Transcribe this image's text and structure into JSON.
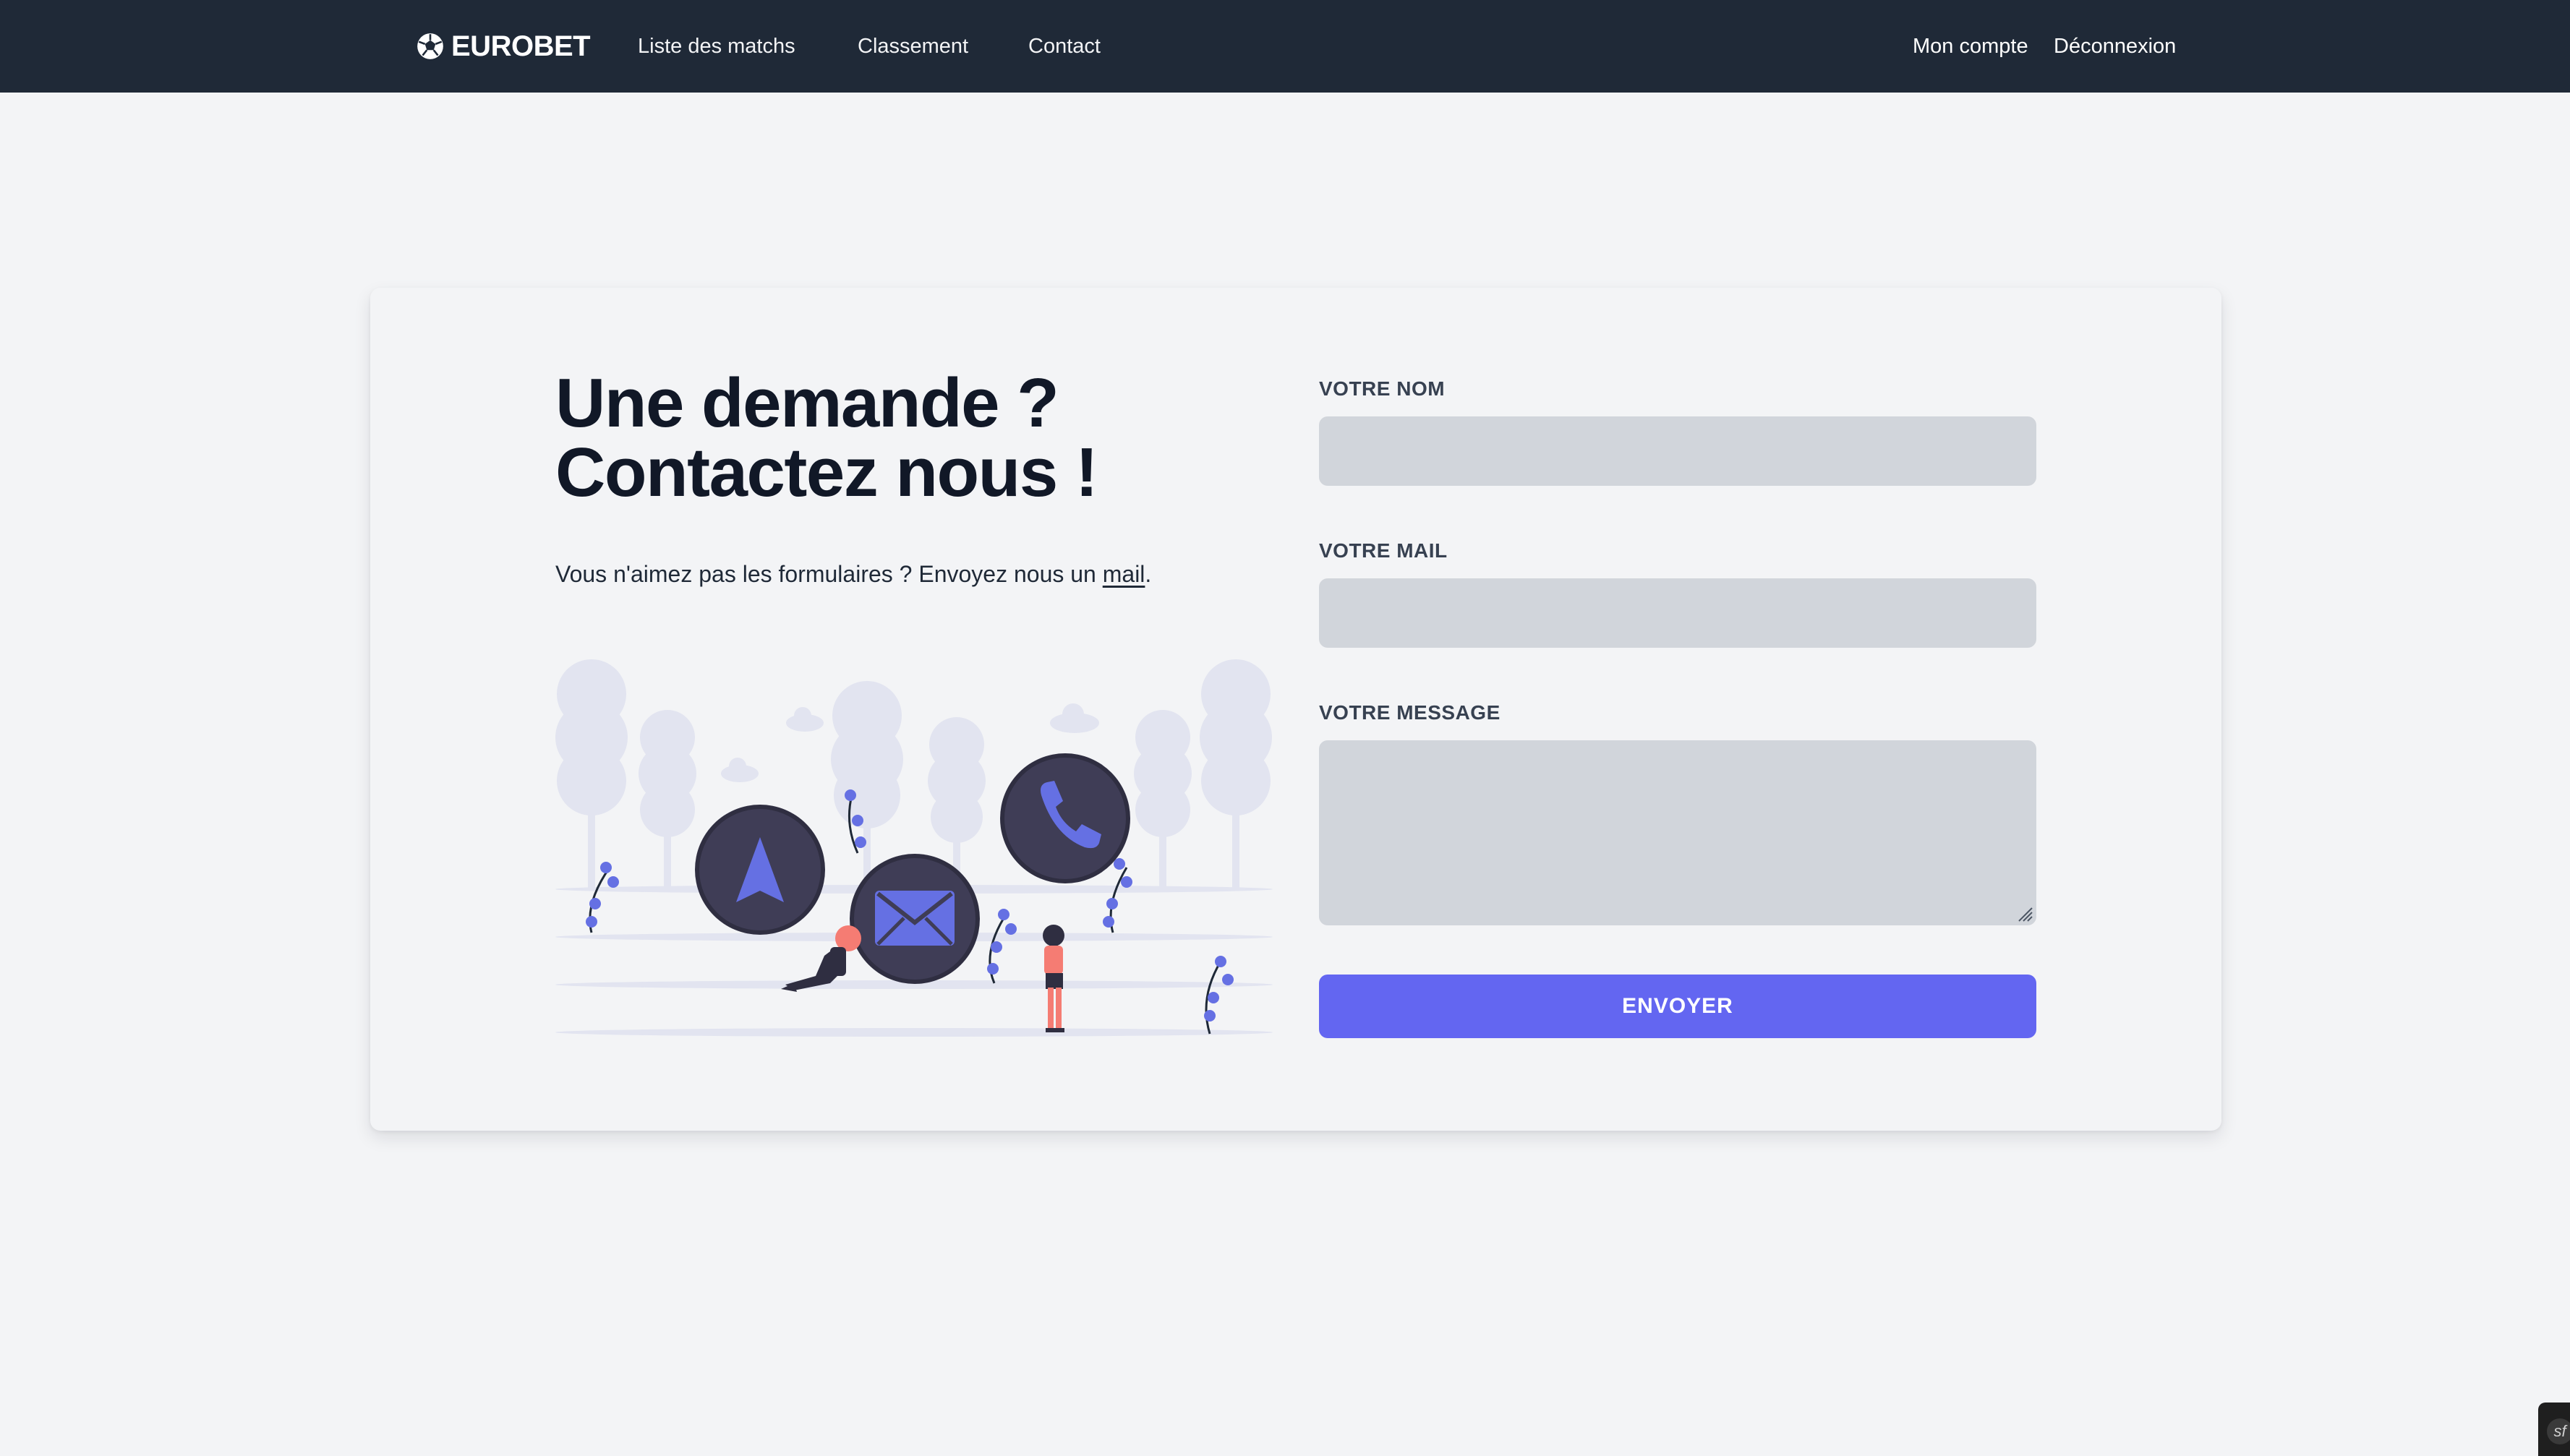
{
  "nav": {
    "brand": "EUROBET",
    "links": [
      "Liste des matchs",
      "Classement",
      "Contact"
    ],
    "account": "Mon compte",
    "logout": "Déconnexion"
  },
  "contact": {
    "title_line1": "Une demande ?",
    "title_line2": "Contactez nous !",
    "lead_prefix": "Vous n'aimez pas les formulaires ? Envoyez nous un ",
    "lead_link": "mail",
    "lead_suffix": "."
  },
  "form": {
    "name_label": "VOTRE NOM",
    "name_value": "",
    "mail_label": "VOTRE MAIL",
    "mail_value": "",
    "message_label": "VOTRE MESSAGE",
    "message_value": "",
    "submit_label": "ENVOYER"
  },
  "colors": {
    "navbar": "#1f2937",
    "page_bg": "#f3f4f6",
    "input_bg": "#d1d5db",
    "accent": "#6366f1",
    "title": "#111827"
  },
  "icons": {
    "brand": "soccer-ball-icon",
    "illustration_circles": [
      "navigation-arrow-icon",
      "envelope-icon",
      "phone-icon"
    ]
  }
}
